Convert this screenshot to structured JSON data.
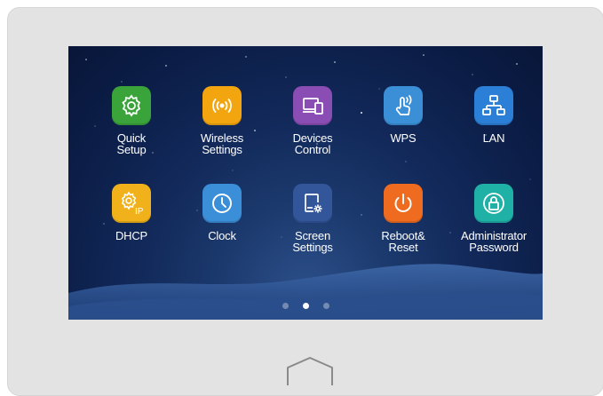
{
  "apps": [
    {
      "label": "Quick\nSetup",
      "icon": "gear-icon",
      "color": "#3aa33a"
    },
    {
      "label": "Wireless\nSettings",
      "icon": "wireless-icon",
      "color": "#f2a50e"
    },
    {
      "label": "Devices\nControl",
      "icon": "devices-icon",
      "color": "#8a4db3"
    },
    {
      "label": "WPS",
      "icon": "touch-icon",
      "color": "#3a8fd6"
    },
    {
      "label": "LAN",
      "icon": "network-icon",
      "color": "#2b7fd6"
    },
    {
      "label": "DHCP",
      "icon": "gear-ip-icon",
      "color": "#f0b11a"
    },
    {
      "label": "Clock",
      "icon": "clock-icon",
      "color": "#3b8ed8"
    },
    {
      "label": "Screen\nSettings",
      "icon": "screen-settings-icon",
      "color": "#33559a"
    },
    {
      "label": "Reboot&\nReset",
      "icon": "power-icon",
      "color": "#ee6b1f"
    },
    {
      "label": "Administrator\nPassword",
      "icon": "lock-icon",
      "color": "#1fb0a6"
    }
  ],
  "pagination": {
    "total": 3,
    "active_index": 1
  }
}
